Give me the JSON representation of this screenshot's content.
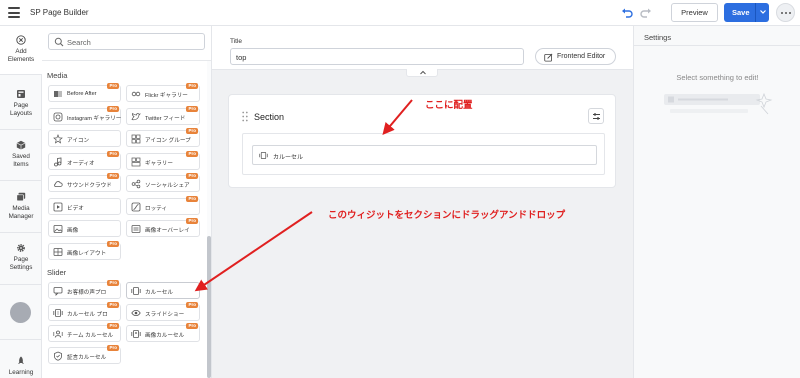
{
  "app": {
    "title": "SP Page Builder"
  },
  "toolbar": {
    "preview_label": "Preview",
    "save_label": "Save"
  },
  "rail": {
    "items": [
      {
        "label_line1": "Add",
        "label_line2": "Elements",
        "icon": "plus-circle-icon"
      },
      {
        "label_line1": "Page",
        "label_line2": "Layouts",
        "icon": "page-layouts-icon"
      },
      {
        "label_line1": "Saved",
        "label_line2": "Items",
        "icon": "box-icon"
      },
      {
        "label_line1": "Media",
        "label_line2": "Manager",
        "icon": "image-gallery-icon"
      },
      {
        "label_line1": "Page",
        "label_line2": "Settings",
        "icon": "gear-icon"
      },
      {
        "label_line1": "Learning",
        "label_line2": "",
        "icon": "rocket-icon"
      }
    ]
  },
  "elements": {
    "search_placeholder": "Search",
    "categories": [
      {
        "name": "Media",
        "items": [
          {
            "label": "Before After",
            "pro": true,
            "icon": "before-after-icon"
          },
          {
            "label": "Flickr ギャラリー",
            "pro": true,
            "icon": "flickr-icon"
          },
          {
            "label": "Instagram ギャラリー",
            "pro": true,
            "icon": "instagram-icon"
          },
          {
            "label": "Twitter フィード",
            "pro": true,
            "icon": "twitter-icon"
          },
          {
            "label": "アイコン",
            "pro": false,
            "icon": "star-icon"
          },
          {
            "label": "アイコン グループ",
            "pro": true,
            "icon": "icon-group-icon"
          },
          {
            "label": "オーディオ",
            "pro": true,
            "icon": "music-note-icon"
          },
          {
            "label": "ギャラリー",
            "pro": true,
            "icon": "gallery-icon"
          },
          {
            "label": "サウンドクラウド",
            "pro": true,
            "icon": "cloud-icon"
          },
          {
            "label": "ソーシャルシェア",
            "pro": true,
            "icon": "share-icon"
          },
          {
            "label": "ビデオ",
            "pro": false,
            "icon": "video-icon"
          },
          {
            "label": "ロッティ",
            "pro": true,
            "icon": "lottie-icon"
          },
          {
            "label": "画像",
            "pro": false,
            "icon": "image-icon"
          },
          {
            "label": "画像オーバーレイ",
            "pro": true,
            "icon": "image-overlay-icon"
          },
          {
            "label": "画像レイアウト",
            "pro": true,
            "icon": "image-layout-icon"
          }
        ]
      },
      {
        "name": "Slider",
        "items": [
          {
            "label": "お客様の声プロ",
            "pro": true,
            "icon": "testimonial-icon"
          },
          {
            "label": "カルーセル",
            "pro": false,
            "icon": "carousel-icon"
          },
          {
            "label": "カルーセル プロ",
            "pro": true,
            "icon": "carousel-pro-icon"
          },
          {
            "label": "スライドショー",
            "pro": true,
            "icon": "eye-icon"
          },
          {
            "label": "チーム カルーセル",
            "pro": true,
            "icon": "team-icon"
          },
          {
            "label": "画像カルーセル",
            "pro": true,
            "icon": "image-carousel-icon"
          },
          {
            "label": "証言カルーセル",
            "pro": true,
            "icon": "badge-icon"
          }
        ]
      }
    ],
    "pro_badge": "Pro"
  },
  "titlebar": {
    "label": "Title",
    "value": "top",
    "frontend_editor": "Frontend Editor"
  },
  "section": {
    "title": "Section",
    "addon_label": "カルーセル"
  },
  "settings": {
    "title": "Settings",
    "empty": "Select something to edit!"
  },
  "annotations": {
    "place_here": "ここに配置",
    "instruction": "このウィジットをセクションにドラッグアンドドロップ"
  },
  "colors": {
    "accent": "#2c6ee0",
    "pro": "#e8833a",
    "annotation": "#e02020"
  }
}
